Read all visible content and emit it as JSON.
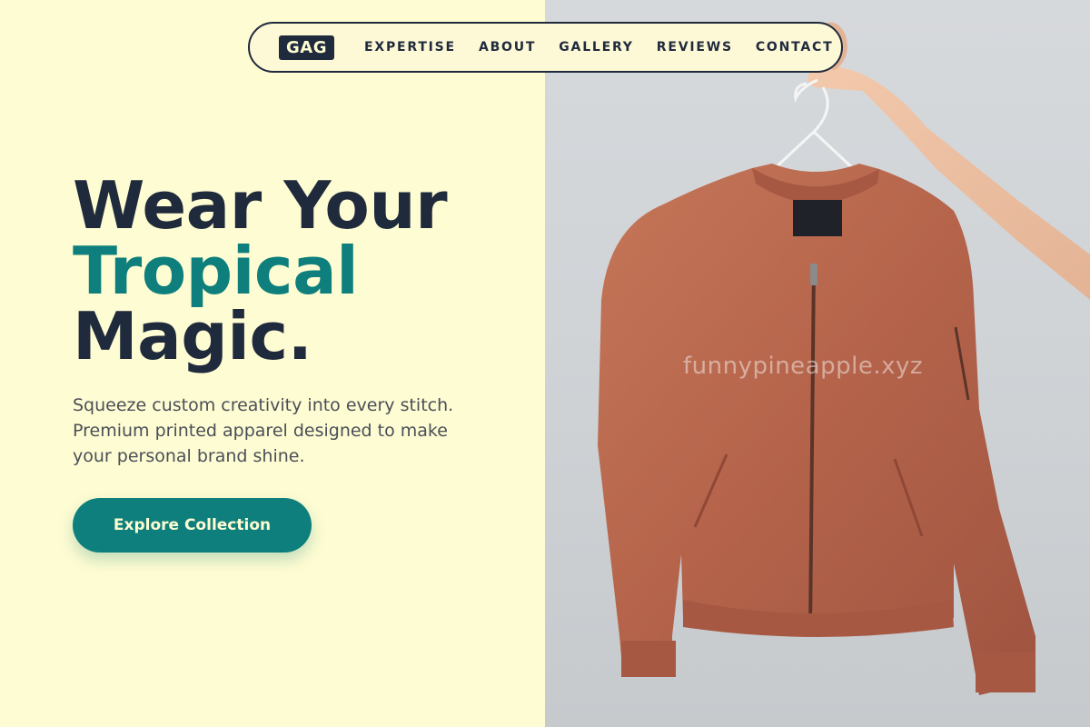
{
  "nav": {
    "logo": "GAG",
    "links": [
      "EXPERTISE",
      "ABOUT",
      "GALLERY",
      "REVIEWS",
      "CONTACT"
    ]
  },
  "hero": {
    "headline_line1": "Wear Your",
    "headline_line2": "Tropical",
    "headline_line3": "Magic.",
    "subtext": "Squeeze custom creativity into every stitch. Premium printed apparel designed to make your personal brand shine.",
    "cta_label": "Explore Collection"
  },
  "watermark": "funnypineapple.xyz",
  "colors": {
    "background": "#fefcd2",
    "dark": "#1f2a3c",
    "accent": "#0e7f7c",
    "jacket": "#b8664e"
  },
  "image": {
    "subject": "jacket-on-hanger-photo"
  }
}
